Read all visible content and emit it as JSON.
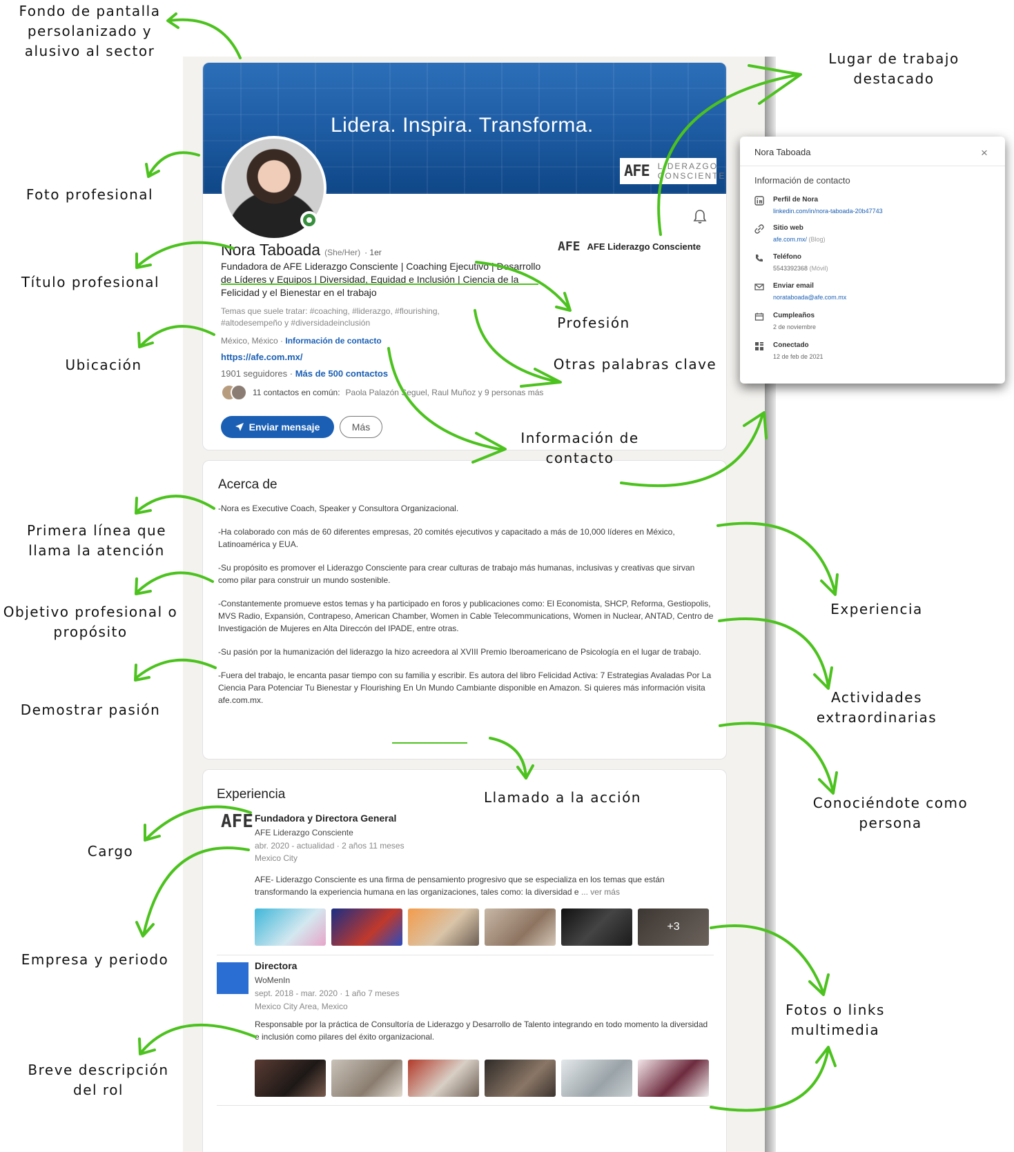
{
  "profile": {
    "banner_tagline": "Lidera. Inspira. Transforma.",
    "banner_logo_mark": "AFE",
    "banner_logo_line1": "LIDERAZGO",
    "banner_logo_line2": "CONSCIENTE",
    "name": "Nora Taboada",
    "pronoun": "(She/Her)",
    "degree": "· 1er",
    "headline": "Fundadora de AFE Liderazgo Consciente | Coaching Ejecutivo | Desarrollo de Líderes y Equipos | Diversidad, Equidad e Inclusión | Ciencia de la Felicidad y el Bienestar en el trabajo",
    "topics": "Temas que suele tratar: #coaching, #liderazgo, #flourishing, #altodesempeño y #diversidadeinclusión",
    "location": "México, México ·",
    "contact_info_link": "Información de contacto",
    "website": "https://afe.com.mx/",
    "followers": "1901 seguidores ·",
    "connections": "Más de 500 contactos",
    "mutual_count": "11 contactos en común:",
    "mutual_names": "Paola Palazón Seguel, Raul Muñoz y 9 personas más",
    "send_message_label": "Enviar mensaje",
    "more_label": "Más",
    "company_logo": "AFE",
    "company_name": "AFE Liderazgo Consciente"
  },
  "about": {
    "title": "Acerca de",
    "paragraphs": [
      "-Nora es Executive Coach, Speaker y Consultora Organizacional.",
      "-Ha colaborado con más de 60 diferentes empresas, 20 comités ejecutivos y capacitado a más de 10,000 líderes en México, Latinoamérica y EUA.",
      "-Su propósito es promover el Liderazgo Consciente para crear culturas de trabajo más humanas, inclusivas y creativas que sirvan como pilar para construir un mundo sostenible.",
      "-Constantemente promueve estos temas y ha participado en foros y publicaciones como: El Economista, SHCP, Reforma, Gestiopolis, MVS Radio, Expansión, Contrapeso, American Chamber, Women in Cable Telecommunications, Women in Nuclear, ANTAD, Centro de Investigación de Mujeres en Alta Direccón del IPADE, entre otras.",
      "-Su pasión por la humanización del liderazgo la hizo acreedora al XVIII Premio Iberoamericano de Psicología en el lugar de trabajo.",
      "-Fuera del trabajo, le encanta pasar tiempo con su familia y escribir. Es autora del libro Felicidad Activa: 7 Estrategias Avaladas Por La Ciencia Para Potenciar Tu Bienestar y Flourishing En Un Mundo Cambiante disponible en Amazon. Si quieres más información"
    ],
    "cta": "visita afe.com.mx."
  },
  "experience": {
    "title": "Experiencia",
    "items": [
      {
        "logo": "AFE",
        "role": "Fundadora y Directora General",
        "company": "AFE Liderazgo Consciente",
        "dates": "abr. 2020 - actualidad · 2 años 11 meses",
        "location": "Mexico City",
        "description": "AFE- Liderazgo Consciente es una firma de pensamiento progresivo que se especializa en los temas que están transformando la experiencia humana en las organizaciones, tales como: la diversidad e",
        "more": "... ver más",
        "media_overflow": "+3"
      },
      {
        "role": "Directora",
        "company": "WoMenIn",
        "dates": "sept. 2018 - mar. 2020 · 1 año 7 meses",
        "location": "Mexico City Area, Mexico",
        "description": "Responsable por la práctica de Consultoría de Liderazgo y Desarrollo de Talento integrando en todo momento la diversidad e inclusión como pilares del éxito organizacional."
      }
    ]
  },
  "contact_popup": {
    "title": "Nora Taboada",
    "close_icon": "×",
    "heading": "Información de contacto",
    "items": [
      {
        "icon": "linkedin-icon",
        "label": "Perfil de Nora",
        "value": "linkedin.com/in/nora-taboada-20b47743"
      },
      {
        "icon": "link-icon",
        "label": "Sitio web",
        "value": "afe.com.mx/",
        "suffix": "(Blog)"
      },
      {
        "icon": "phone-icon",
        "label": "Teléfono",
        "value": "5543392368",
        "suffix": "(Móvil)"
      },
      {
        "icon": "email-icon",
        "label": "Enviar email",
        "value": "norataboada@afe.com.mx"
      },
      {
        "icon": "calendar-icon",
        "label": "Cumpleaños",
        "value": "2 de noviembre"
      },
      {
        "icon": "people-icon",
        "label": "Conectado",
        "value": "12 de feb de 2021"
      }
    ]
  },
  "annotations": {
    "fondo": "Fondo de pantalla persolanizado y alusivo al sector",
    "foto": "Foto profesional",
    "titulo": "Título profesional",
    "ubicacion": "Ubicación",
    "primera_linea": "Primera línea que llama la atención",
    "objetivo": "Objetivo profesional o propósito",
    "pasion": "Demostrar pasión",
    "cargo": "Cargo",
    "empresa": "Empresa y periodo",
    "breve": "Breve descripción del rol",
    "lugar": "Lugar de trabajo destacado",
    "profesion": "Profesión",
    "palabras": "Otras palabras clave",
    "contacto": "Información de contacto",
    "experiencia": "Experiencia",
    "actividades": "Actividades extraordinarias",
    "conociendote": "Conociéndote como persona",
    "llamado": "Llamado a la acción",
    "fotos": "Fotos o links multimedia"
  },
  "colors": {
    "linkedin_blue": "#1a5fb4",
    "arrow_green": "#4cc21e",
    "banner_blue": "#1f5ea6"
  }
}
